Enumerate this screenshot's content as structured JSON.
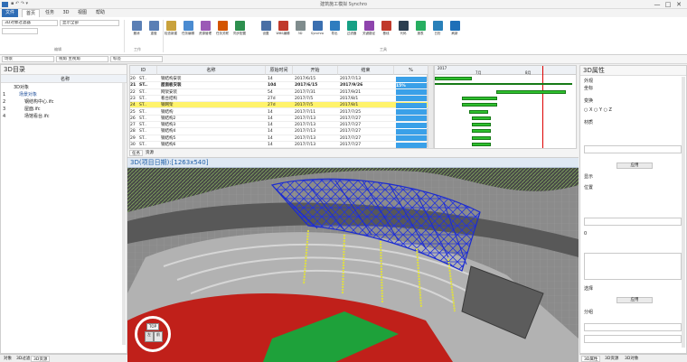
{
  "window": {
    "title": "建筑施工模拟 Synchro",
    "controls": [
      "—",
      "□",
      "✕"
    ]
  },
  "tabs": [
    "文件",
    "首页",
    "任务",
    "3D",
    "视图",
    "帮助"
  ],
  "ribbon": {
    "buttons": [
      {
        "label": "撤消",
        "icon": "undo-icon",
        "color": "#5a7fb5"
      },
      {
        "label": "重做",
        "icon": "redo-icon",
        "color": "#5a7fb5"
      },
      {
        "label": "检查新建",
        "icon": "check-icon",
        "color": "#c9a23c"
      },
      {
        "label": "任务编辑",
        "icon": "task-icon",
        "color": "#4a8bd1"
      },
      {
        "label": "资源管理",
        "icon": "resource-icon",
        "color": "#9b59b6"
      },
      {
        "label": "任务关联",
        "icon": "link-icon",
        "color": "#d35400"
      },
      {
        "label": "同步配置",
        "icon": "sync-icon",
        "color": "#2d8f4e"
      },
      {
        "label": "设置",
        "icon": "gear-icon",
        "color": "#4a6fa5"
      },
      {
        "label": "WBS编辑",
        "icon": "wbs-icon",
        "color": "#c0392b"
      },
      {
        "label": "3D",
        "icon": "cube-icon",
        "color": "#7f8c8d"
      },
      {
        "label": "Synchro",
        "icon": "synchro-icon",
        "color": "#3a6fb0"
      },
      {
        "label": "导出",
        "icon": "export-icon",
        "color": "#2e7dbf"
      },
      {
        "label": "过滤器",
        "icon": "filter-icon",
        "color": "#16a085"
      },
      {
        "label": "关键路径",
        "icon": "path-icon",
        "color": "#8e44ad"
      },
      {
        "label": "基线",
        "icon": "baseline-icon",
        "color": "#c0392b"
      },
      {
        "label": "代码",
        "icon": "code-icon",
        "color": "#2c3e50"
      },
      {
        "label": "报表",
        "icon": "report-icon",
        "color": "#27ae60"
      },
      {
        "label": "日历",
        "icon": "calendar-icon",
        "color": "#2980b9"
      },
      {
        "label": "刷新",
        "icon": "refresh-icon",
        "color": "#1e6fb8"
      }
    ],
    "groups": [
      "编辑",
      "工作",
      "工具"
    ],
    "left_fields": [
      "3D对象过滤器",
      "显示全部"
    ]
  },
  "toolbar2": {
    "fields": [
      "场景",
      "视角 主视角",
      "标签"
    ]
  },
  "tree": {
    "title": "3D目录",
    "column": "名称",
    "items": [
      {
        "num": "",
        "label": "3D对象",
        "indent": 0
      },
      {
        "num": "1",
        "label": "场景对象",
        "indent": 1
      },
      {
        "num": "2",
        "label": "钢结构中心.ifc",
        "indent": 2
      },
      {
        "num": "3",
        "label": "屋面.ifc",
        "indent": 2
      },
      {
        "num": "4",
        "label": "场馆看台.ifc",
        "indent": 2
      }
    ]
  },
  "gantt": {
    "columns": [
      "ID",
      "名称",
      "原始时间",
      "开始",
      "结束",
      "%"
    ],
    "rows": [
      {
        "num": "20",
        "id": "ST..",
        "name": "钢结构安装",
        "dur": "14",
        "start": "2017/6/15",
        "end": "2017/7/13",
        "pct": ""
      },
      {
        "num": "21",
        "id": "ST..",
        "name": "屋面板安装",
        "dur": "104",
        "start": "2017/6/15",
        "end": "2017/9/26",
        "pct": "15%"
      },
      {
        "num": "22",
        "id": "ST..",
        "name": "网架安装",
        "dur": "54",
        "start": "2017/7/31",
        "end": "2017/9/21",
        "pct": ""
      },
      {
        "num": "23",
        "id": "ST..",
        "name": "看台结构",
        "dur": "27d",
        "start": "2017/7/5",
        "end": "2017/8/1",
        "pct": ""
      },
      {
        "num": "24",
        "id": "ST..",
        "name": "钢网架",
        "dur": "27d",
        "start": "2017/7/5",
        "end": "2017/8/1",
        "pct": ""
      },
      {
        "num": "25",
        "id": "ST..",
        "name": "钢结构",
        "dur": "14",
        "start": "2017/7/11",
        "end": "2017/7/25",
        "pct": ""
      },
      {
        "num": "26",
        "id": "ST..",
        "name": "钢结构2",
        "dur": "14",
        "start": "2017/7/13",
        "end": "2017/7/27",
        "pct": ""
      },
      {
        "num": "27",
        "id": "ST..",
        "name": "钢结构3",
        "dur": "14",
        "start": "2017/7/13",
        "end": "2017/7/27",
        "pct": ""
      },
      {
        "num": "28",
        "id": "ST..",
        "name": "钢结构4",
        "dur": "14",
        "start": "2017/7/13",
        "end": "2017/7/27",
        "pct": ""
      },
      {
        "num": "29",
        "id": "ST..",
        "name": "钢结构5",
        "dur": "14",
        "start": "2017/7/13",
        "end": "2017/7/27",
        "pct": ""
      },
      {
        "num": "30",
        "id": "ST..",
        "name": "钢结构6",
        "dur": "14",
        "start": "2017/7/13",
        "end": "2017/7/27",
        "pct": ""
      }
    ],
    "bottom_tabs": [
      "任务",
      "资源"
    ],
    "chart_header": [
      "2017",
      "7月",
      "8月"
    ]
  },
  "viewport": {
    "title": "3D(项目日期):[1263x540]",
    "cube_labels": [
      "TOP",
      "左",
      "前"
    ]
  },
  "props": {
    "title": "3D属性",
    "items": [
      "外观",
      "坐标",
      "变换",
      "材质",
      "显示",
      "位置",
      "选择",
      "分组"
    ],
    "radio": [
      "X",
      "Y",
      "Z"
    ],
    "button": "应用",
    "value_lbl": "0",
    "bottom_tabs": [
      "3D属性",
      "3D资源",
      "3D对象"
    ]
  },
  "left_tabs": [
    "对象",
    "3D过滤",
    "3D资源"
  ]
}
